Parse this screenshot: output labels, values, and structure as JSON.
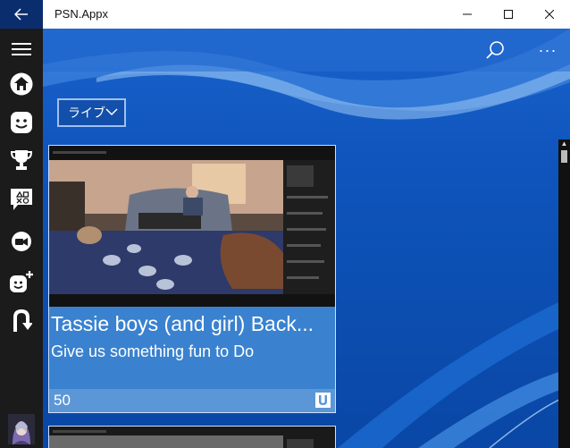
{
  "window": {
    "title": "PSN.Appx"
  },
  "nav": {
    "items": [
      {
        "name": "home-icon"
      },
      {
        "name": "friends-icon"
      },
      {
        "name": "trophy-icon"
      },
      {
        "name": "playstation-symbols-icon"
      },
      {
        "name": "live-broadcast-icon"
      },
      {
        "name": "add-friend-icon"
      },
      {
        "name": "second-screen-icon"
      }
    ]
  },
  "filter": {
    "label": "ライブ"
  },
  "cards": [
    {
      "title": "Tassie boys (and girl) Back...",
      "subtitle": "Give us something fun to Do",
      "viewers": "50",
      "service_icon": "ustream-icon"
    }
  ],
  "colors": {
    "accent": "#0c4fb2",
    "rail": "#1b1b1b",
    "card": "#3a82cf"
  }
}
